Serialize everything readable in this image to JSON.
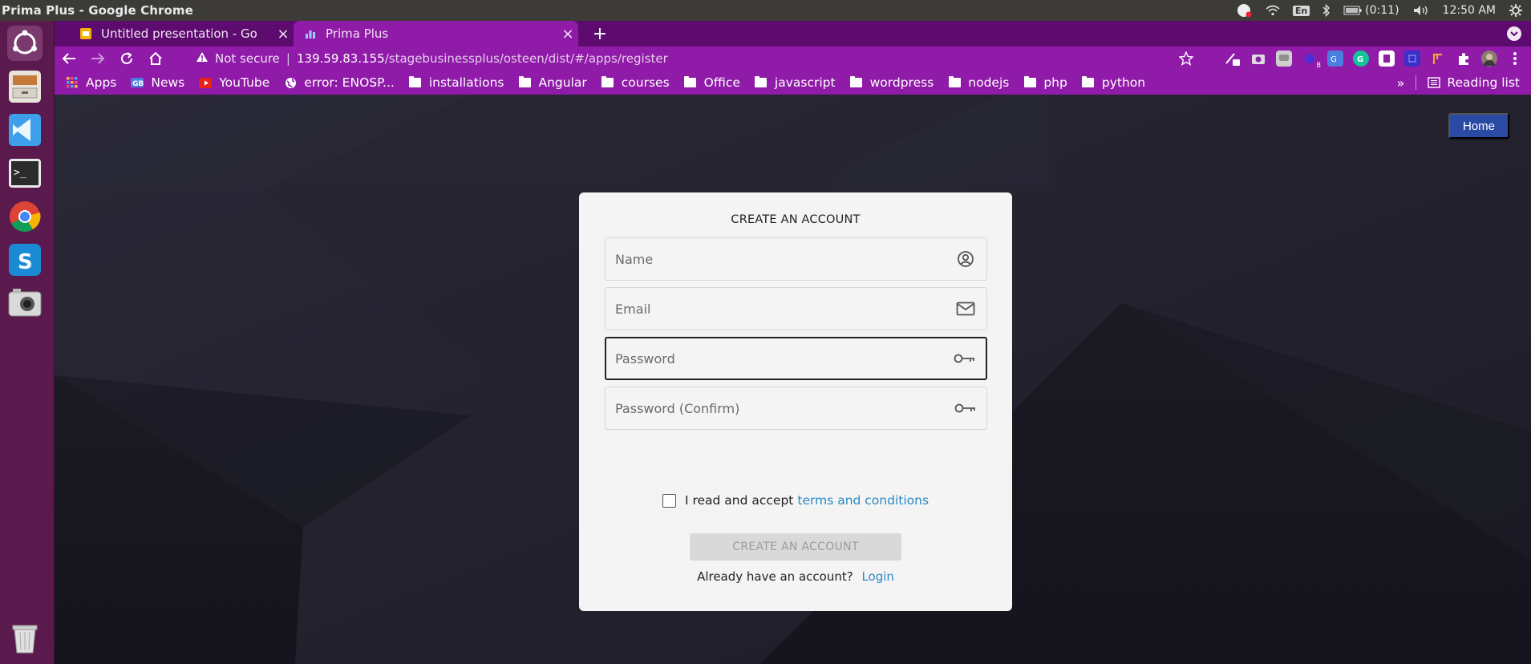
{
  "os": {
    "window_title": "Prima Plus - Google Chrome",
    "tray": {
      "language": "En",
      "battery": "(0:11)",
      "time": "12:50 AM"
    }
  },
  "chrome": {
    "tabs": [
      {
        "title": "Untitled presentation - Go",
        "active": false
      },
      {
        "title": "Prima Plus",
        "active": true
      }
    ],
    "omnibox": {
      "security_label": "Not secure",
      "host": "139.59.83.155",
      "path": "/stagebusinessplus/osteen/dist/#/apps/register"
    },
    "extensions": {
      "badge_count": "8"
    },
    "bookmarks": [
      {
        "label": "Apps",
        "icon": "apps-grid-icon"
      },
      {
        "label": "News",
        "icon": "news-icon"
      },
      {
        "label": "YouTube",
        "icon": "youtube-icon"
      },
      {
        "label": "error: ENOSP...",
        "icon": "globe-icon"
      },
      {
        "label": "installations",
        "icon": "folder-icon"
      },
      {
        "label": "Angular",
        "icon": "folder-icon"
      },
      {
        "label": "courses",
        "icon": "folder-icon"
      },
      {
        "label": "Office",
        "icon": "folder-icon"
      },
      {
        "label": "javascript",
        "icon": "folder-icon"
      },
      {
        "label": "wordpress",
        "icon": "folder-icon"
      },
      {
        "label": "nodejs",
        "icon": "folder-icon"
      },
      {
        "label": "php",
        "icon": "folder-icon"
      },
      {
        "label": "python",
        "icon": "folder-icon"
      }
    ],
    "bookmarks_more": "»",
    "reading_list": "Reading list"
  },
  "page": {
    "home_button": "Home",
    "form": {
      "heading": "CREATE AN ACCOUNT",
      "name_placeholder": "Name",
      "email_placeholder": "Email",
      "password_placeholder": "Password",
      "password_confirm_placeholder": "Password (Confirm)",
      "terms_prefix": "I read and accept",
      "terms_link": "terms and conditions",
      "submit_label": "CREATE AN ACCOUNT",
      "login_prompt": "Already have an account?",
      "login_link": "Login"
    }
  },
  "colors": {
    "tab_strip": "#5d0b6e",
    "toolbar": "#8f1ba8",
    "home_button": "#2b4aa3",
    "link": "#2a8ac4",
    "card": "#f4f4f4"
  }
}
